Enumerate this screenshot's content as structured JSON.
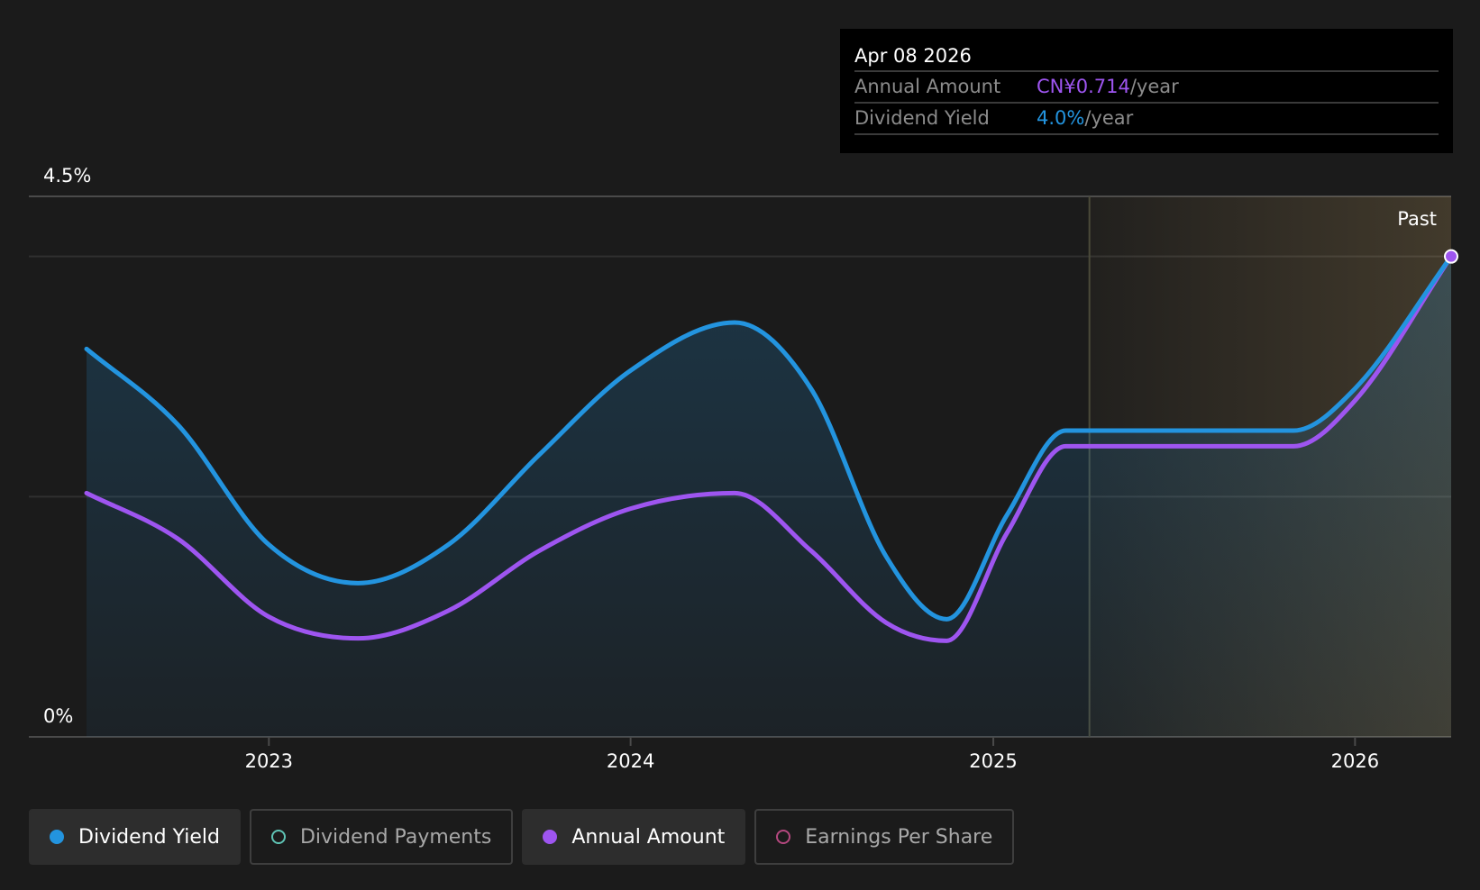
{
  "tooltip": {
    "date": "Apr 08 2026",
    "annual_amount_label": "Annual Amount",
    "annual_amount_value": "CN¥0.714",
    "dividend_yield_label": "Dividend Yield",
    "dividend_yield_value": "4.0%",
    "unit": "/year"
  },
  "legend": [
    {
      "label": "Dividend Yield",
      "color": "#2394df",
      "active": true
    },
    {
      "label": "Dividend Payments",
      "color": "#5fc4b5",
      "active": false
    },
    {
      "label": "Annual Amount",
      "color": "#9e55f0",
      "active": true
    },
    {
      "label": "Earnings Per Share",
      "color": "#b5487f",
      "active": false
    }
  ],
  "chart_data": {
    "type": "line",
    "y_top_label": "4.5%",
    "y_bottom_label": "0%",
    "ylim": [
      0,
      4.5
    ],
    "x_range": [
      "2022-07-01",
      "2026-04-08"
    ],
    "x_ticks": [
      "2023",
      "2024",
      "2025",
      "2026"
    ],
    "past_label": "Past",
    "past_region_start": "2025-04-08",
    "grid": true,
    "series": [
      {
        "name": "Dividend Yield",
        "color": "#2394df",
        "x": [
          "2022-07-01",
          "2022-10-01",
          "2023-01-01",
          "2023-04-01",
          "2023-07-01",
          "2023-10-01",
          "2024-01-01",
          "2024-04-15",
          "2024-07-01",
          "2024-09-15",
          "2024-11-15",
          "2025-01-15",
          "2025-03-15",
          "2025-04-08",
          "2025-07-01",
          "2025-10-31",
          "2026-01-01",
          "2026-04-08"
        ],
        "values": [
          3.23,
          2.6,
          1.6,
          1.28,
          1.6,
          2.35,
          3.05,
          3.45,
          2.9,
          1.5,
          0.98,
          1.85,
          2.55,
          2.55,
          2.55,
          2.55,
          2.9,
          4.0
        ]
      },
      {
        "name": "Annual Amount",
        "color": "#9e55f0",
        "x": [
          "2022-07-01",
          "2022-10-01",
          "2023-01-01",
          "2023-04-01",
          "2023-07-01",
          "2023-10-01",
          "2024-01-01",
          "2024-04-15",
          "2024-07-01",
          "2024-09-15",
          "2024-11-15",
          "2025-01-15",
          "2025-03-15",
          "2025-04-08",
          "2025-07-01",
          "2025-10-31",
          "2026-01-01",
          "2026-04-08"
        ],
        "values": [
          2.03,
          1.65,
          1.0,
          0.82,
          1.05,
          1.55,
          1.9,
          2.03,
          1.55,
          0.95,
          0.8,
          1.7,
          2.42,
          2.42,
          2.42,
          2.42,
          2.8,
          4.0
        ]
      }
    ]
  }
}
